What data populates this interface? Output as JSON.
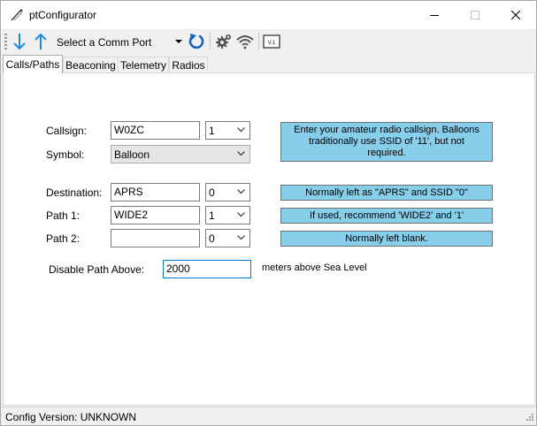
{
  "window": {
    "title": "ptConfigurator"
  },
  "toolbar": {
    "download_icon": "arrow-down-icon",
    "upload_icon": "arrow-up-icon",
    "port_select": "Select a Comm Port",
    "refresh_icon": "refresh-icon",
    "settings_icon": "gear-icon",
    "wireless_icon": "wifi-icon",
    "version_icon": "version-icon",
    "version_icon_text": "V.1"
  },
  "tabs": [
    {
      "label": "Calls/Paths",
      "active": true
    },
    {
      "label": "Beaconing",
      "active": false
    },
    {
      "label": "Telemetry",
      "active": false
    },
    {
      "label": "Radios",
      "active": false
    }
  ],
  "form": {
    "callsign": {
      "label": "Callsign:",
      "value": "W0ZC",
      "ssid": "1"
    },
    "symbol": {
      "label": "Symbol:",
      "value": "Balloon"
    },
    "destination": {
      "label": "Destination:",
      "value": "APRS",
      "ssid": "0"
    },
    "path1": {
      "label": "Path 1:",
      "value": "WIDE2",
      "ssid": "1"
    },
    "path2": {
      "label": "Path 2:",
      "value": "",
      "ssid": "0"
    },
    "disable_path": {
      "label": "Disable Path Above:",
      "value": "2000",
      "unit": "meters above Sea Level"
    }
  },
  "hints": {
    "callsign": "Enter your amateur radio callsign.  Balloons traditionally use SSID of '11', but not required.",
    "destination": "Normally left as \"APRS\" and SSID \"0\"",
    "path1": "If used, recommend  'WIDE2' and '1'",
    "path2": "Normally left blank."
  },
  "status": {
    "text": "Config Version: UNKNOWN"
  },
  "colors": {
    "hint_bg": "#87ceeb",
    "accent": "#0078d7",
    "arrow_blue": "#1e88e5"
  }
}
